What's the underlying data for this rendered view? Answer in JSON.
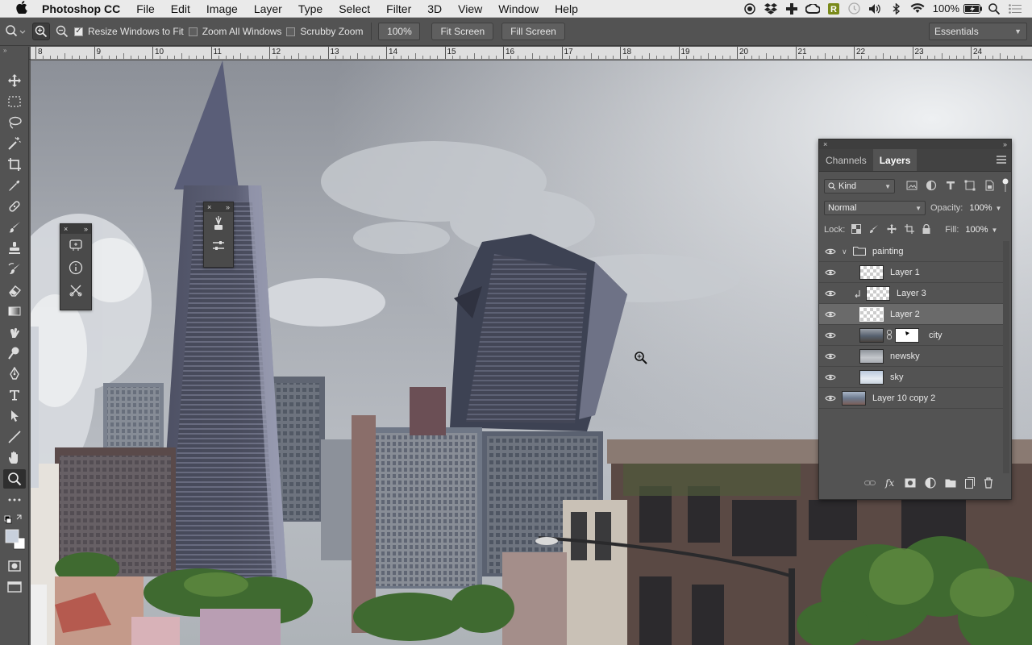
{
  "menubar": {
    "apple": "",
    "app_name": "Photoshop CC",
    "menus": [
      "File",
      "Edit",
      "Image",
      "Layer",
      "Type",
      "Select",
      "Filter",
      "3D",
      "View",
      "Window",
      "Help"
    ],
    "battery_percent": "100%",
    "status_icons": [
      "record-icon",
      "dropbox-icon",
      "plus-cross-icon",
      "creative-cloud-icon",
      "r-app-icon",
      "time-machine-icon",
      "volume-icon",
      "bluetooth-icon",
      "wifi-icon",
      "battery-icon",
      "spotlight-icon",
      "notification-list-icon"
    ]
  },
  "options_bar": {
    "resize_windows_to_fit": "Resize Windows to Fit",
    "resize_windows_checked": true,
    "zoom_all_windows": "Zoom All Windows",
    "zoom_all_checked": false,
    "scrubby_zoom": "Scrubby Zoom",
    "scrubby_checked": false,
    "zoom_value": "100%",
    "fit_screen": "Fit Screen",
    "fill_screen": "Fill Screen",
    "workspace": "Essentials"
  },
  "ruler": {
    "labels": [
      "8",
      "9",
      "10",
      "11",
      "12",
      "13",
      "14",
      "15",
      "16",
      "17",
      "18",
      "19",
      "20",
      "21",
      "22",
      "23",
      "24"
    ]
  },
  "tools": [
    "move-tool",
    "marquee-tool",
    "lasso-tool",
    "magic-wand-tool",
    "crop-tool",
    "eyedropper-tool",
    "healing-brush-tool",
    "brush-tool",
    "clone-stamp-tool",
    "history-brush-tool",
    "eraser-tool",
    "gradient-tool",
    "smudge-tool",
    "dodge-tool",
    "pen-tool",
    "type-tool",
    "path-selection-tool",
    "line-tool",
    "hand-tool",
    "zoom-tool",
    "edit-toolbar",
    "swap-colors",
    "color-swatches",
    "quick-mask",
    "screen-mode"
  ],
  "layers_panel": {
    "tabs": [
      "Channels",
      "Layers"
    ],
    "active_tab": "Layers",
    "filter_kind": "Kind",
    "blend_mode": "Normal",
    "opacity_label": "Opacity:",
    "opacity_value": "100%",
    "lock_label": "Lock:",
    "fill_label": "Fill:",
    "fill_value": "100%",
    "layers": [
      {
        "name": "painting",
        "type": "group",
        "selected": false
      },
      {
        "name": "Layer 1",
        "type": "layer",
        "selected": false
      },
      {
        "name": "Layer 3",
        "type": "clipped",
        "selected": false
      },
      {
        "name": "Layer 2",
        "type": "layer",
        "selected": true
      },
      {
        "name": "city",
        "type": "masked",
        "selected": false
      },
      {
        "name": "newsky",
        "type": "layer",
        "selected": false
      },
      {
        "name": "sky",
        "type": "layer",
        "selected": false
      },
      {
        "name": "Layer 10 copy 2",
        "type": "layer",
        "selected": false
      }
    ]
  },
  "colors": {
    "ui_dark": "#535353",
    "panel_selected": "#6a6a6a",
    "menubar": "#eaeaea"
  }
}
